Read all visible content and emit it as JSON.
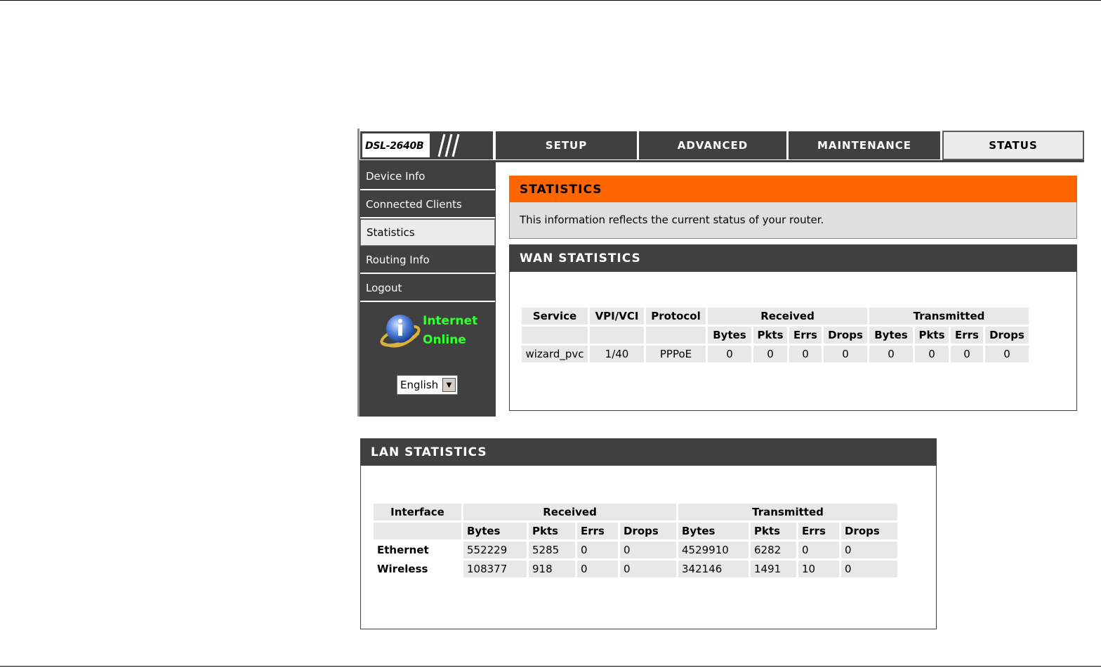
{
  "logo": {
    "model": "DSL-2640B"
  },
  "nav": {
    "tabs": [
      {
        "label": "SETUP"
      },
      {
        "label": "ADVANCED"
      },
      {
        "label": "MAINTENANCE"
      },
      {
        "label": "STATUS"
      }
    ],
    "active": "STATUS"
  },
  "sidebar": {
    "items": [
      {
        "label": "Device Info"
      },
      {
        "label": "Connected Clients"
      },
      {
        "label": "Statistics"
      },
      {
        "label": "Routing Info"
      },
      {
        "label": "Logout"
      }
    ],
    "active": "Statistics",
    "internet_status": {
      "line1": "Internet",
      "line2": "Online",
      "color": "#33ff33"
    },
    "language": {
      "selected": "English"
    }
  },
  "statistics": {
    "title": "STATISTICS",
    "description": "This information reflects the current status of your router.",
    "accent": "#ff6600"
  },
  "wan": {
    "title": "WAN STATISTICS",
    "headers": {
      "service": "Service",
      "vpivci": "VPI/VCI",
      "protocol": "Protocol",
      "received": "Received",
      "transmitted": "Transmitted",
      "sub": [
        "Bytes",
        "Pkts",
        "Errs",
        "Drops",
        "Bytes",
        "Pkts",
        "Errs",
        "Drops"
      ]
    },
    "rows": [
      {
        "service": "wizard_pvc",
        "vpivci": "1/40",
        "protocol": "PPPoE",
        "values": [
          "0",
          "0",
          "0",
          "0",
          "0",
          "0",
          "0",
          "0"
        ]
      }
    ]
  },
  "lan": {
    "title": "LAN STATISTICS",
    "headers": {
      "interface": "Interface",
      "received": "Received",
      "transmitted": "Transmitted",
      "sub": [
        "Bytes",
        "Pkts",
        "Errs",
        "Drops",
        "Bytes",
        "Pkts",
        "Errs",
        "Drops"
      ]
    },
    "rows": [
      {
        "interface": "Ethernet",
        "values": [
          "552229",
          "5285",
          "0",
          "0",
          "4529910",
          "6282",
          "0",
          "0"
        ]
      },
      {
        "interface": "Wireless",
        "values": [
          "108377",
          "918",
          "0",
          "0",
          "342146",
          "1491",
          "10",
          "0"
        ]
      }
    ]
  },
  "colors": {
    "nav_dark": "#404040",
    "cell_bg": "#e8e8e8"
  }
}
